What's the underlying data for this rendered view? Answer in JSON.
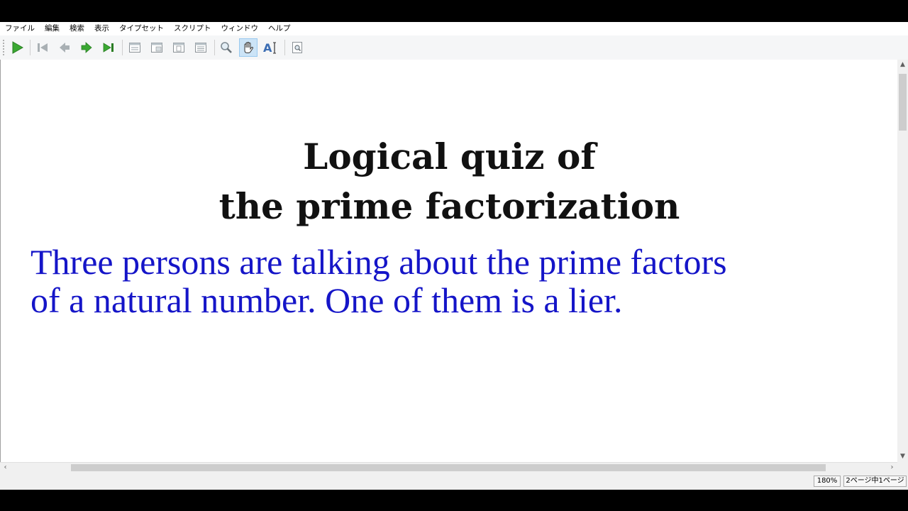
{
  "menubar": {
    "items": [
      {
        "label": "ファイル"
      },
      {
        "label": "編集"
      },
      {
        "label": "検索"
      },
      {
        "label": "表示"
      },
      {
        "label": "タイプセット"
      },
      {
        "label": "スクリプト"
      },
      {
        "label": "ウィンドウ"
      },
      {
        "label": "ヘルプ"
      }
    ]
  },
  "toolbar": {
    "buttons": [
      {
        "icon": "typeset-play-icon"
      },
      {
        "icon": "first-page-icon"
      },
      {
        "icon": "previous-page-icon"
      },
      {
        "icon": "next-page-icon"
      },
      {
        "icon": "last-page-icon"
      },
      {
        "icon": "actual-size-icon"
      },
      {
        "icon": "fit-width-icon"
      },
      {
        "icon": "fit-page-icon"
      },
      {
        "icon": "fit-window-icon"
      },
      {
        "icon": "magnify-icon"
      },
      {
        "icon": "hand-tool-icon"
      },
      {
        "icon": "select-text-icon"
      },
      {
        "icon": "find-icon"
      }
    ],
    "active_tool": "hand-tool-icon"
  },
  "document": {
    "title_line1": "Logical quiz of",
    "title_line2": "the prime factorization",
    "body_line1": "Three persons are talking about the prime factors",
    "body_line2": "of a natural number. One of them is a lier.",
    "colors": {
      "title": "#111111",
      "body": "#1515c8"
    }
  },
  "statusbar": {
    "zoom": "180%",
    "page_info": "2ページ中1ページ"
  }
}
